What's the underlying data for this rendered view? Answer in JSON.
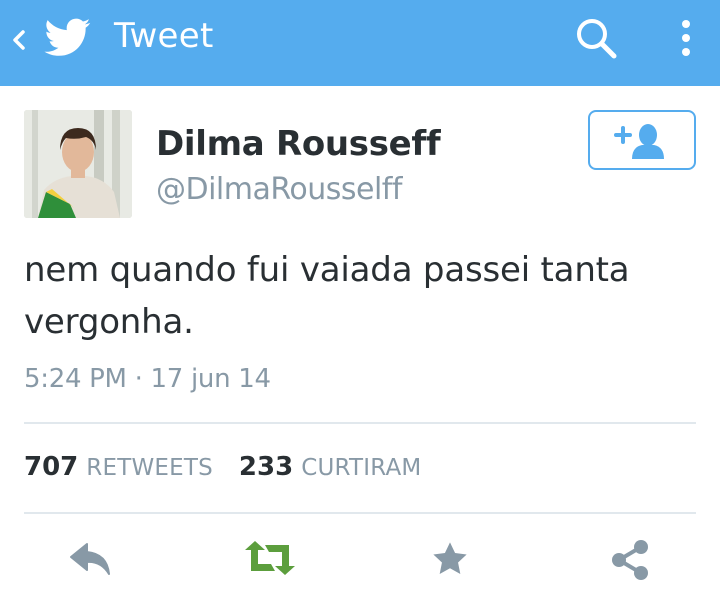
{
  "appbar": {
    "title": "Tweet",
    "back_icon": "chevron-left-icon",
    "logo_icon": "twitter-bird-icon",
    "search_icon": "search-icon",
    "overflow_icon": "more-vertical-icon",
    "color": "#55acee"
  },
  "tweet": {
    "author": {
      "display_name": "Dilma Rousseff",
      "handle": "@DilmaRousselff"
    },
    "follow_icon": "add-user-icon",
    "text": "nem quando fui vaiada passei tanta vergonha.",
    "timestamp": "5:24 PM · 17 jun 14",
    "stats": {
      "retweets_count": "707",
      "retweets_label": "RETWEETS",
      "likes_count": "233",
      "likes_label": "CURTIRAM"
    },
    "actions": [
      {
        "name": "reply",
        "icon": "reply-icon",
        "color": "#8899a6"
      },
      {
        "name": "retweet",
        "icon": "retweet-icon",
        "color": "#5c9e3d"
      },
      {
        "name": "favorite",
        "icon": "star-icon",
        "color": "#8899a6"
      },
      {
        "name": "share",
        "icon": "share-icon",
        "color": "#8899a6"
      }
    ]
  },
  "colors": {
    "accent": "#55acee",
    "text": "#292f33",
    "muted": "#8899a6",
    "divider": "#e1e8ed",
    "retweet": "#5c9e3d"
  }
}
